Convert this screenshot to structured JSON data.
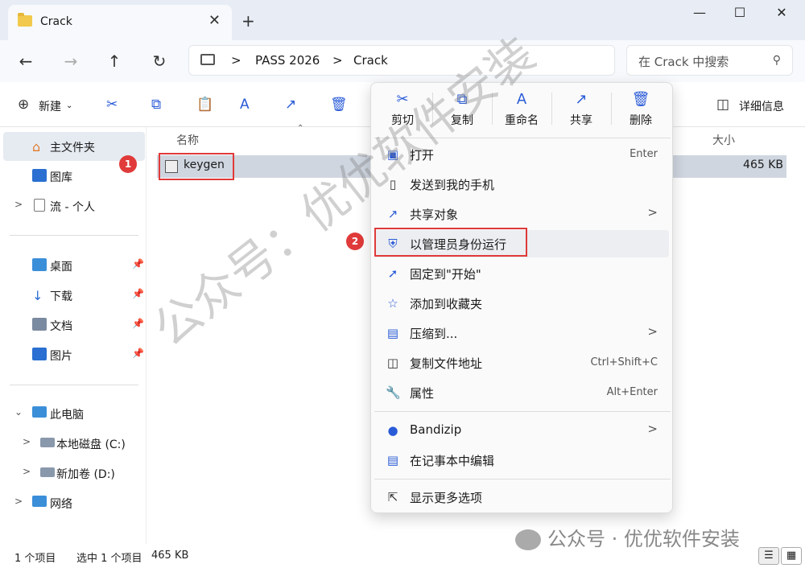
{
  "tab": {
    "label": "Crack",
    "close": "✕",
    "new": "+"
  },
  "window": {
    "minimize": "—",
    "maximize": "☐",
    "close": "✕"
  },
  "nav": {
    "back": "←",
    "forward": "→",
    "up": "↑",
    "refresh": "↻",
    "breadcrumbs": [
      "PASS 2026",
      "Crack"
    ],
    "separator": ">",
    "search_placeholder": "在 Crack 中搜索"
  },
  "toolbar": {
    "new_label": "新建",
    "details_label": "详细信息"
  },
  "sidebar": {
    "home": "主文件夹",
    "gallery": "图库",
    "personal": "流 - 个人",
    "desktop": "桌面",
    "downloads": "下载",
    "documents": "文档",
    "pictures": "图片",
    "this_pc": "此电脑",
    "drive_c": "本地磁盘 (C:)",
    "drive_d": "新加卷 (D:)",
    "network": "网络"
  },
  "columns": {
    "name": "名称",
    "size": "大小"
  },
  "file": {
    "name": "keygen",
    "size": "465 KB"
  },
  "badges": [
    "1",
    "2"
  ],
  "context_menu": {
    "actions": [
      {
        "label": "剪切",
        "icon": "scissors-icon"
      },
      {
        "label": "复制",
        "icon": "copy-icon"
      },
      {
        "label": "重命名",
        "icon": "rename-icon"
      },
      {
        "label": "共享",
        "icon": "share-icon"
      },
      {
        "label": "删除",
        "icon": "trash-icon"
      }
    ],
    "items": [
      {
        "label": "打开",
        "shortcut": "Enter"
      },
      {
        "label": "发送到我的手机",
        "shortcut": ""
      },
      {
        "label": "共享对象",
        "shortcut": ""
      },
      {
        "label": "以管理员身份运行",
        "shortcut": ""
      },
      {
        "label": "固定到\"开始\"",
        "shortcut": ""
      },
      {
        "label": "添加到收藏夹",
        "shortcut": ""
      },
      {
        "label": "压缩到...",
        "shortcut": ""
      },
      {
        "label": "复制文件地址",
        "shortcut": "Ctrl+Shift+C"
      },
      {
        "label": "属性",
        "shortcut": "Alt+Enter"
      },
      {
        "label": "Bandizip",
        "shortcut": ""
      },
      {
        "label": "在记事本中编辑",
        "shortcut": ""
      },
      {
        "label": "显示更多选项",
        "shortcut": ""
      }
    ]
  },
  "status": {
    "count": "1 个项目",
    "selected": "选中 1 个项目",
    "size": "465 KB"
  },
  "watermark": {
    "diagonal": "公众号：优优软件安装",
    "bottom": "公众号 · 优优软件安装"
  },
  "colors": {
    "accent": "#2a5bd7",
    "highlight_box": "#e03a3a",
    "selection": "#cfd6e0"
  }
}
